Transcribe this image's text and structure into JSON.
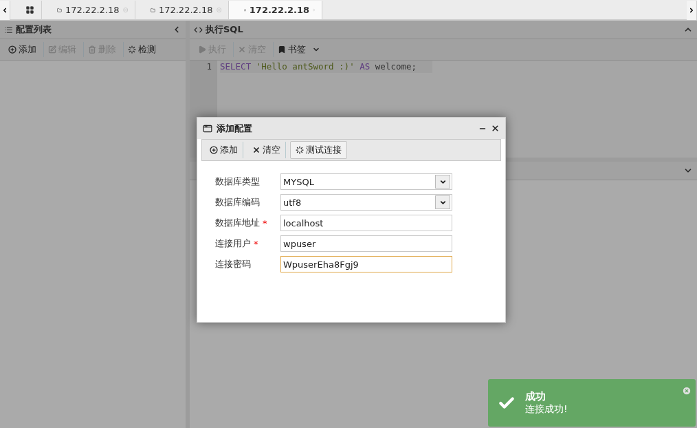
{
  "tabs": [
    {
      "kind": "home",
      "selected": false
    },
    {
      "kind": "folder",
      "label": "172.22.2.18",
      "selected": false
    },
    {
      "kind": "folder",
      "label": "172.22.2.18",
      "selected": false
    },
    {
      "kind": "database",
      "label": "172.22.2.18",
      "selected": true
    }
  ],
  "config_panel": {
    "title": "配置列表",
    "toolbar": [
      {
        "kind": "add",
        "label": "添加",
        "disabled": false
      },
      {
        "kind": "edit",
        "label": "编辑",
        "disabled": true
      },
      {
        "kind": "delete",
        "label": "删除",
        "disabled": true
      },
      {
        "kind": "check",
        "label": "检测",
        "disabled": false
      }
    ]
  },
  "sql_panel": {
    "title": "执行SQL",
    "toolbar": [
      {
        "kind": "run",
        "label": "执行",
        "disabled": true
      },
      {
        "kind": "clear",
        "label": "清空",
        "disabled": true
      },
      {
        "kind": "bookmark",
        "label": "书签",
        "disabled": false
      }
    ],
    "editor": {
      "lines": [
        {
          "number": "1",
          "tokens": [
            {
              "kind": "keyword",
              "text": "SELECT"
            },
            {
              "kind": "string",
              "text": "'Hello antSword :)'"
            },
            {
              "kind": "keyword",
              "text": "AS"
            },
            {
              "kind": "plain",
              "text": "welcome;"
            }
          ]
        }
      ]
    }
  },
  "dialog": {
    "title": "添加配置",
    "toolbar": [
      {
        "kind": "add",
        "label": "添加"
      },
      {
        "kind": "clear",
        "label": "清空"
      },
      {
        "kind": "test",
        "label": "测试连接"
      }
    ],
    "fields": [
      {
        "kind": "select",
        "label": "数据库类型",
        "value": "MYSQL",
        "focused": false
      },
      {
        "kind": "select",
        "label": "数据库编码",
        "value": "utf8",
        "focused": false
      },
      {
        "kind": "input",
        "label": "数据库地址",
        "required_mark": "*",
        "value": "localhost",
        "focused": false
      },
      {
        "kind": "input",
        "label": "连接用户",
        "required_mark": "*",
        "value": "wpuser",
        "focused": false
      },
      {
        "kind": "input",
        "label": "连接密码",
        "value": "WpuserEha8Fgj9",
        "focused": true
      }
    ]
  },
  "toast": {
    "title": "成功",
    "message": "连接成功!"
  }
}
